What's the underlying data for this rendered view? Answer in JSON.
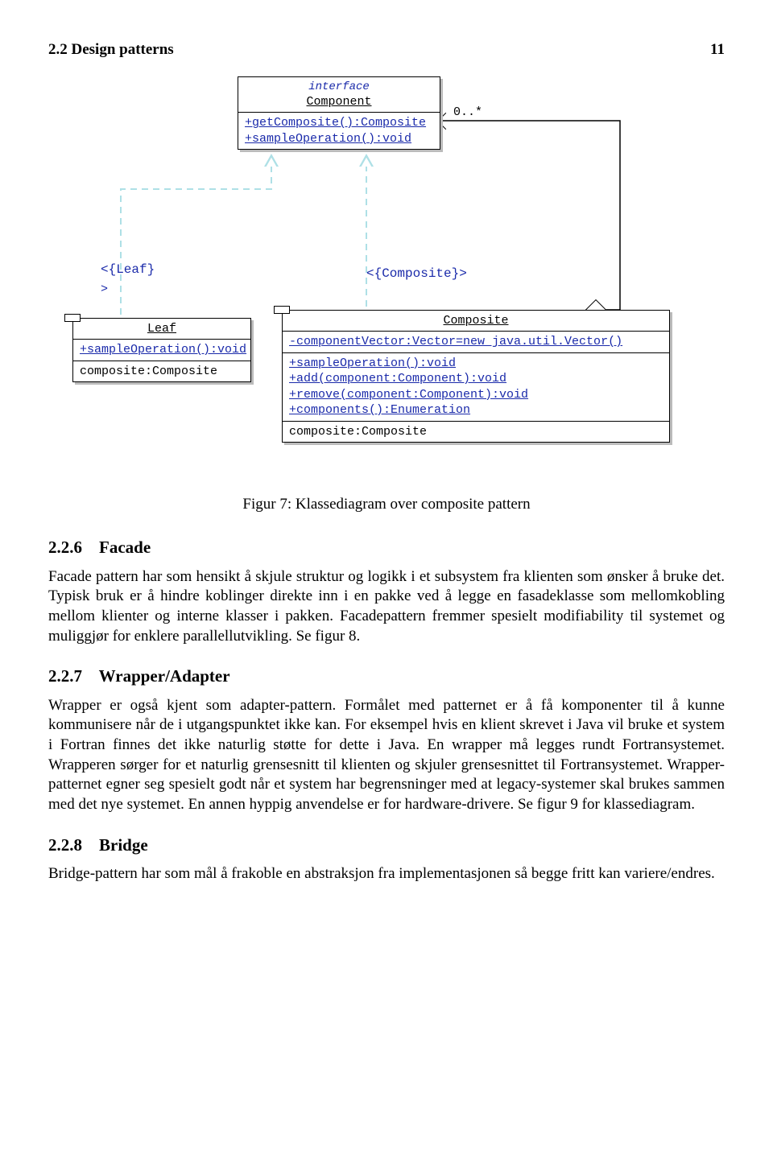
{
  "header": {
    "left": "2.2   Design patterns",
    "right": "11"
  },
  "uml": {
    "component": {
      "stereo": "interface",
      "name": "Component",
      "ops": [
        "+getComposite():Composite",
        "+sampleOperation():void"
      ]
    },
    "leaf": {
      "label": "<{Leaf}",
      "name": "Leaf",
      "ops": [
        "+sampleOperation():void"
      ],
      "bottom": "composite:Composite"
    },
    "composite": {
      "label": "<{Composite}>",
      "name": "Composite",
      "attr": "-componentVector:Vector=new java.util.Vector()",
      "ops": [
        "+sampleOperation():void",
        "+add(component:Component):void",
        "+remove(component:Component):void",
        "+components():Enumeration"
      ],
      "bottom": "composite:Composite"
    },
    "multiplicity": "0..*"
  },
  "figcap": "Figur 7: Klassediagram over composite pattern",
  "s226": {
    "num": "2.2.6",
    "title": "Facade",
    "text": "Facade pattern har som hensikt å skjule struktur og logikk i et subsystem fra klienten som ønsker å bruke det. Typisk bruk er å hindre koblinger direkte inn i en pakke ved å legge en fasadeklasse som mellomkobling mellom klienter og interne klasser i pakken. Facadepattern fremmer spesielt modifiability til systemet og muliggjør for enklere parallellutvikling. Se figur 8."
  },
  "s227": {
    "num": "2.2.7",
    "title": "Wrapper/Adapter",
    "text": "Wrapper er også kjent som adapter-pattern. Formålet med patternet er å få komponenter til å kunne kommunisere når de i utgangspunktet ikke kan. For eksempel hvis en klient skrevet i Java vil bruke et system i Fortran finnes det ikke naturlig støtte for dette i Java. En wrapper må legges rundt Fortransystemet. Wrapperen sørger for et naturlig grensesnitt til klienten og skjuler grensesnittet til Fortransystemet. Wrapper-patternet egner seg spesielt godt når et system har begrensninger med at legacy-systemer skal brukes sammen med det nye systemet. En annen hyppig anvendelse er for hardware-drivere. Se figur 9 for klassediagram."
  },
  "s228": {
    "num": "2.2.8",
    "title": "Bridge",
    "text": "Bridge-pattern har som mål å frakoble en abstraksjon fra implementasjonen så begge fritt kan variere/endres."
  }
}
